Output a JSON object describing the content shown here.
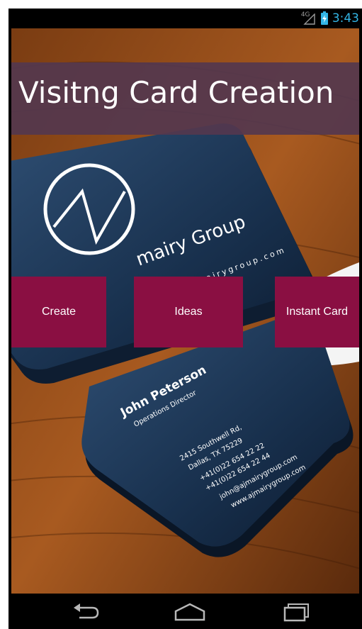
{
  "status_bar": {
    "network": "4G",
    "time": "3:43",
    "icons": [
      "signal-icon",
      "battery-charging-icon"
    ]
  },
  "app": {
    "title": "Visitng Card Creation"
  },
  "buttons": {
    "create": "Create",
    "ideas": "Ideas",
    "instant_card": "Instant Card"
  },
  "background_card": {
    "company": "mairy Group",
    "website_vertical": "www.ajmairygroup.com",
    "name": "John Peterson",
    "role": "Operations Director",
    "address1": "2415 Southwell Rd,",
    "address2": "Dallas, TX 75229",
    "phone1": "+41(0)22 654 22 22",
    "phone2": "+41(0)22 654 22 44",
    "email": "john@ajmairygroup.com",
    "web": "www.ajmairygroup.com"
  },
  "nav_bar": {
    "icons": [
      "back-icon",
      "home-icon",
      "recent-apps-icon"
    ]
  },
  "colors": {
    "title_bar": "#54374e",
    "button": "#8a0f42",
    "status_accent": "#33b5e5"
  }
}
